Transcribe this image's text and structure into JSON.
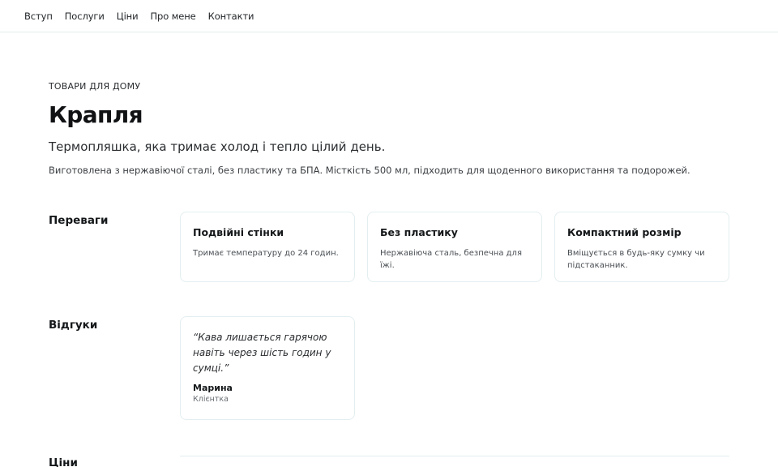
{
  "nav": {
    "items": [
      "Вступ",
      "Послуги",
      "Ціни",
      "Про мене",
      "Контакти"
    ]
  },
  "hero": {
    "eyebrow": "ТОВАРИ ДЛЯ ДОМУ",
    "title": "Крапля",
    "subtitle": "Термопляшка, яка тримає холод і тепло цілий день.",
    "description": "Виготовлена з нержавіючої сталі, без пластику та БПА. Місткість 500 мл, підходить для щоденного використання та подорожей."
  },
  "advantages": {
    "label": "Переваги",
    "cards": [
      {
        "title": "Подвійні стінки",
        "text": "Тримає температуру до 24 годин."
      },
      {
        "title": "Без пластику",
        "text": "Нержавіюча сталь, безпечна для їжі."
      },
      {
        "title": "Компактний розмір",
        "text": "Вміщується в будь-яку сумку чи підстаканник."
      }
    ]
  },
  "reviews": {
    "label": "Відгуки",
    "items": [
      {
        "quote": "“Кава лишається гарячою навіть через шість годин у сумці.”",
        "author": "Марина",
        "role": "Клієнтка"
      }
    ]
  },
  "prices": {
    "label": "Ціни"
  }
}
